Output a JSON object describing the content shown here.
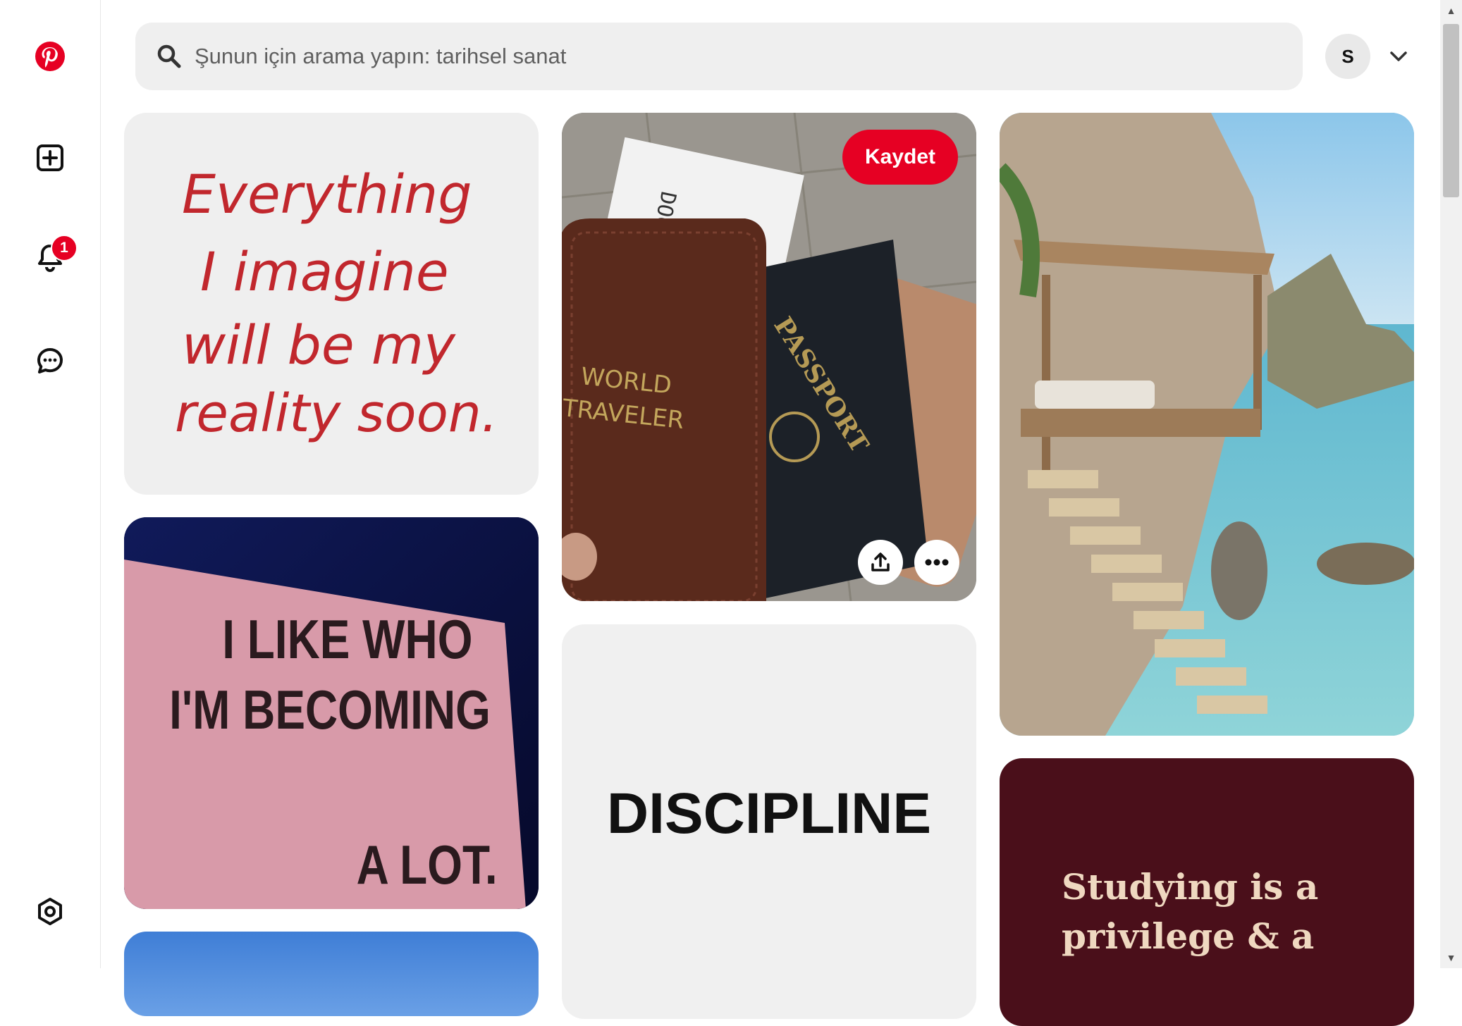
{
  "search": {
    "placeholder": "Şunun için arama yapın: tarihsel sanat"
  },
  "header": {
    "avatar_initial": "S"
  },
  "notifications": {
    "count": "1"
  },
  "pins": {
    "quote1": {
      "lines": [
        "Everything",
        "I imagine",
        "will be my",
        "reality soon."
      ]
    },
    "passport": {
      "save_label": "Kaydet",
      "wallet_text": [
        "WORLD",
        "TRAVELER"
      ],
      "passport_text": "PASSPORT",
      "ticket_text": "DOCS"
    },
    "sign": {
      "lines": [
        "I LIKE WHO",
        "I'M BECOMING",
        "A LOT."
      ]
    },
    "discipline": {
      "text": "DISCIPLINE"
    },
    "studying": {
      "lines": [
        "Studying is a",
        "privilege & a"
      ]
    }
  },
  "colors": {
    "brand": "#e60023",
    "studying_bg": "#4a0f1a",
    "sign_pink": "#d89aa9"
  }
}
